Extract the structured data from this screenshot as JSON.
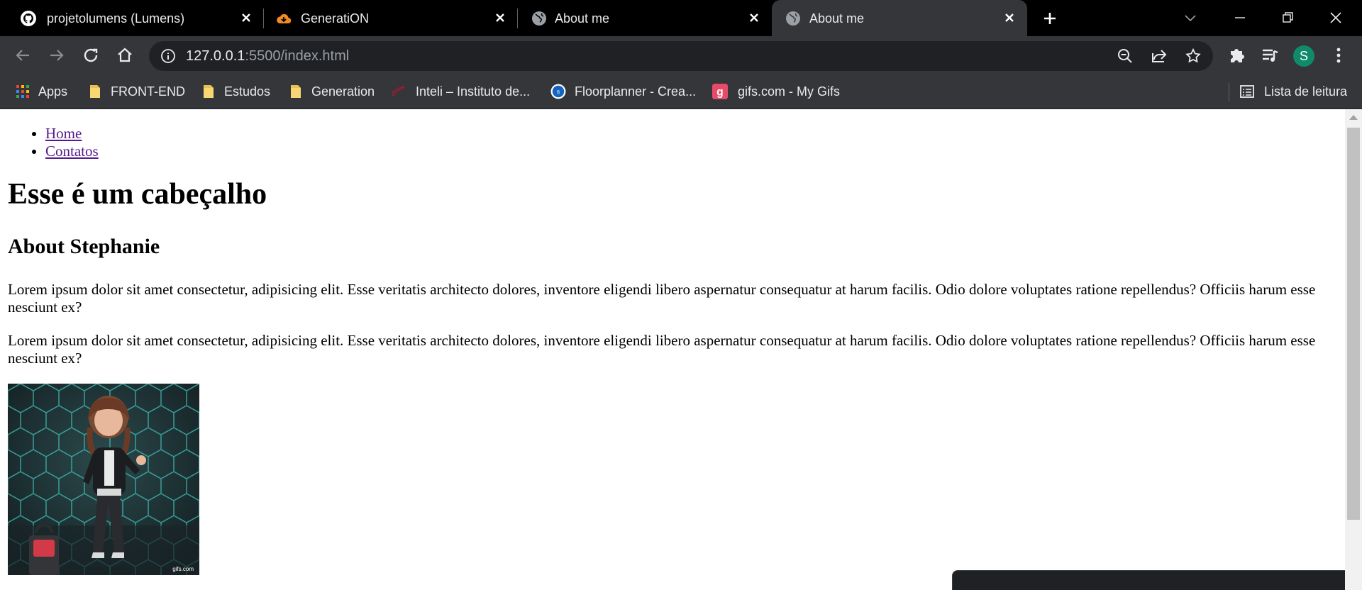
{
  "browser": {
    "tabs": [
      {
        "title": "projetolumens (Lumens)",
        "icon": "github-icon"
      },
      {
        "title": "GeneratiON",
        "icon": "cloud-icon"
      },
      {
        "title": "About me",
        "icon": "globe-icon"
      },
      {
        "title": "About me",
        "icon": "globe-icon",
        "active": true
      }
    ],
    "address": {
      "host": "127.0.0.1",
      "path": ":5500/index.html"
    },
    "profile_initial": "S",
    "bookmarks": [
      {
        "label": "Apps",
        "icon": "apps-grid-icon"
      },
      {
        "label": "FRONT-END",
        "icon": "folder-icon"
      },
      {
        "label": "Estudos",
        "icon": "folder-icon"
      },
      {
        "label": "Generation",
        "icon": "folder-icon"
      },
      {
        "label": "Inteli – Instituto de...",
        "icon": "inteli-icon"
      },
      {
        "label": "Floorplanner - Crea...",
        "icon": "floorplanner-icon"
      },
      {
        "label": "gifs.com - My Gifs",
        "icon": "gifs-icon"
      }
    ],
    "reading_list": "Lista de leitura"
  },
  "page": {
    "nav": [
      "Home",
      "Contatos"
    ],
    "heading": "Esse é um cabeçalho",
    "subheading": "About Stephanie",
    "paragraphs": [
      "Lorem ipsum dolor sit amet consectetur, adipisicing elit. Esse veritatis architecto dolores, inventore eligendi libero aspernatur consequatur at harum facilis. Odio dolore voluptates ratione repellendus? Officiis harum esse nesciunt ex?",
      "Lorem ipsum dolor sit amet consectetur, adipisicing elit. Esse veritatis architecto dolores, inventore eligendi libero aspernatur consequatur at harum facilis. Odio dolore voluptates ratione repellendus? Officiis harum esse nesciunt ex?"
    ],
    "gif_watermark": "gifs.com"
  },
  "colors": {
    "tabstrip": "#000000",
    "toolbar": "#35363a",
    "omnibox": "#202124",
    "visited_link": "#551a8b",
    "avatar": "#0f8a6b"
  }
}
